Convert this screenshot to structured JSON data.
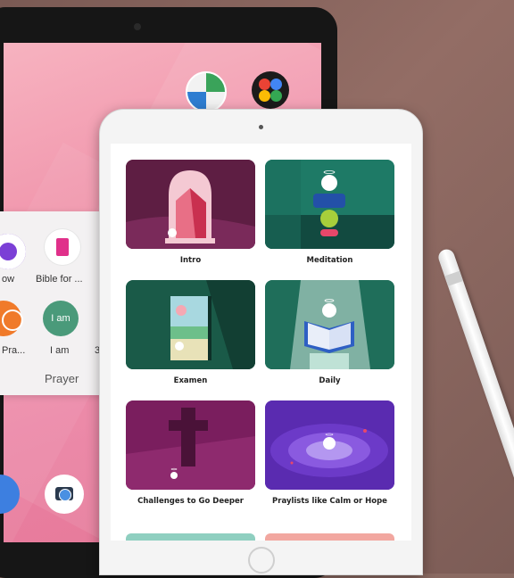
{
  "launcher": {
    "folder_name": "Prayer",
    "apps": [
      {
        "label": "ow"
      },
      {
        "label": "Bible for ..."
      },
      {
        "label": "Pra..."
      },
      {
        "label": "I am",
        "icon_text": "I am"
      },
      {
        "label": "3"
      }
    ]
  },
  "app": {
    "cards": [
      {
        "title": "Intro"
      },
      {
        "title": "Meditation"
      },
      {
        "title": "Examen"
      },
      {
        "title": "Daily"
      },
      {
        "title": "Challenges to Go Deeper"
      },
      {
        "title": "Praylists like Calm or Hope"
      }
    ]
  },
  "colors": {
    "pink_wallpaper": "#ef8fa8",
    "intro_card": "#5e1e43",
    "meditation_card": "#1e7a66",
    "examen_card": "#1a5a48",
    "daily_card": "#1f6e5a",
    "challenges_card": "#7a1e5e",
    "praylists_card": "#5a2bb0"
  }
}
